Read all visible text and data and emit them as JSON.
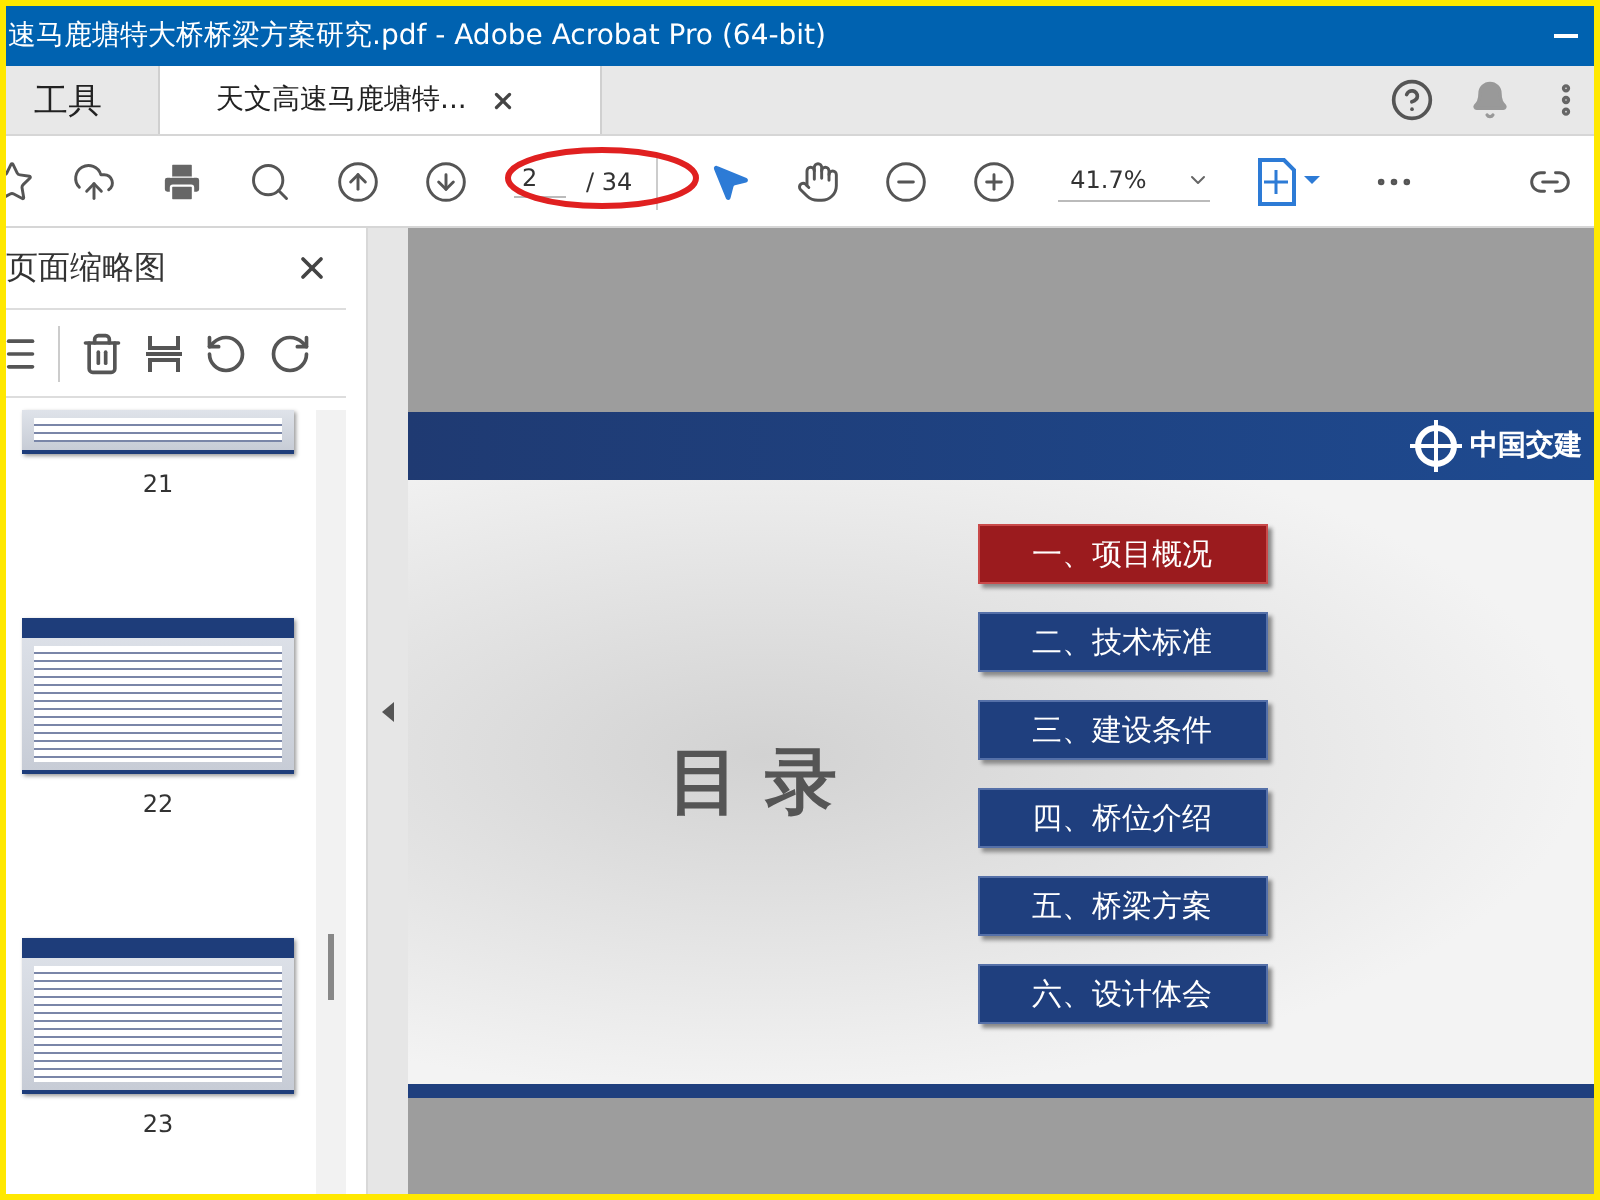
{
  "window": {
    "title": "速马鹿塘特大桥桥梁方案研究.pdf - Adobe Acrobat Pro (64-bit)"
  },
  "tabs": [
    {
      "label": "工具",
      "selected": false
    },
    {
      "label": "天文高速马鹿塘特...",
      "selected": true
    }
  ],
  "toolbar": {
    "page_current": "2",
    "page_total": "/ 34",
    "zoom": "41.7%"
  },
  "sidebar": {
    "title": "页面缩略图",
    "thumbnails": [
      {
        "page": "21"
      },
      {
        "page": "22"
      },
      {
        "page": "23"
      }
    ]
  },
  "slide": {
    "logo_text": "中国交建",
    "heading": "目 录",
    "items": [
      {
        "label": "一、项目概况",
        "selected": true
      },
      {
        "label": "二、技术标准",
        "selected": false
      },
      {
        "label": "三、建设条件",
        "selected": false
      },
      {
        "label": "四、桥位介绍",
        "selected": false
      },
      {
        "label": "五、桥梁方案",
        "selected": false
      },
      {
        "label": "六、设计体会",
        "selected": false
      }
    ]
  }
}
